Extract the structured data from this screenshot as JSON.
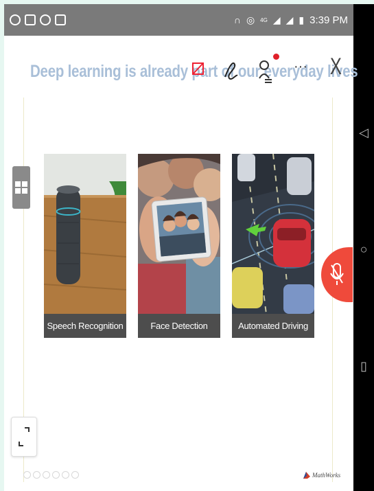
{
  "status_bar": {
    "time": "3:39 PM",
    "network": "4G",
    "left_icons": [
      "whatsapp-icon",
      "image-icon",
      "sync-icon",
      "camera-icon"
    ],
    "right_icons": [
      "headset-icon",
      "hotspot-icon",
      "signal-icon",
      "signal-icon",
      "battery-icon"
    ]
  },
  "slide": {
    "title": "Deep learning is already part of our everyday lives",
    "toolbar": {
      "pen_icon": "pen-icon",
      "presenter_icon": "presenter-icon",
      "more_label": "···",
      "close_label": "X"
    },
    "cards": [
      {
        "caption": "Speech Recognition",
        "image": "smart-speaker"
      },
      {
        "caption": "Face Detection",
        "image": "selfie-phone"
      },
      {
        "caption": "Automated Driving",
        "image": "self-driving-car"
      }
    ],
    "footer_logo": "MathWorks"
  },
  "colors": {
    "title": "#a9bfd8",
    "mic_button": "#ef4a3b",
    "caption_bg": "#4d4d4d",
    "status_bar": "#7a7a7a"
  }
}
